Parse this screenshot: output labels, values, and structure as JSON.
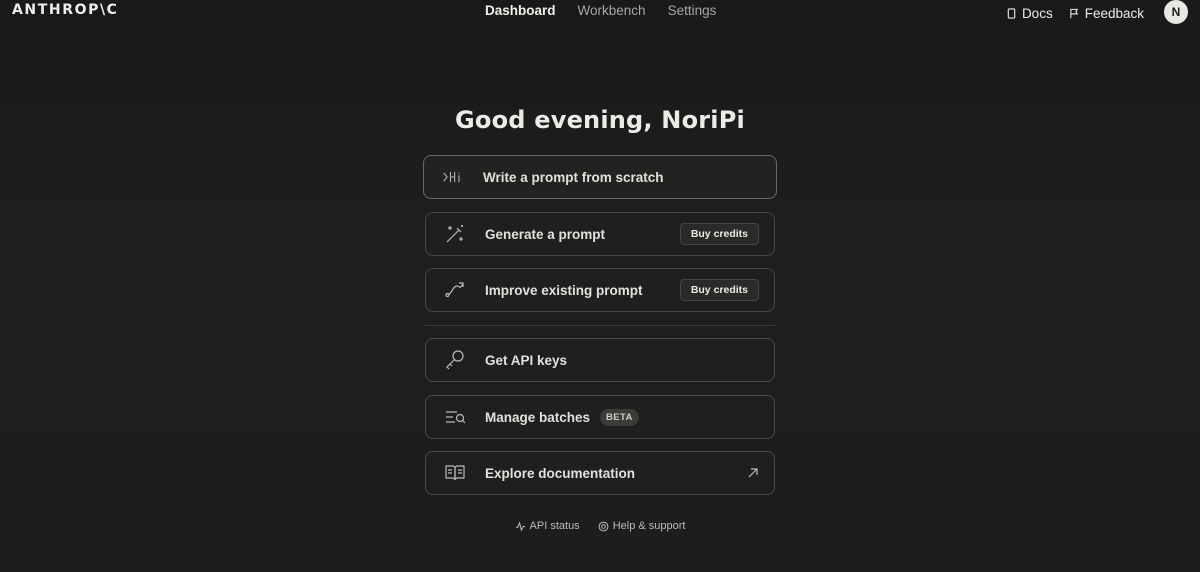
{
  "header": {
    "logo": "ANTHROP\\C",
    "tabs": [
      {
        "label": "Dashboard",
        "active": true
      },
      {
        "label": "Workbench",
        "active": false
      },
      {
        "label": "Settings",
        "active": false
      }
    ],
    "docs_label": "Docs",
    "feedback_label": "Feedback",
    "avatar_initial": "N"
  },
  "greeting": "Good evening, NoriPi",
  "actions": [
    {
      "label": "Write a prompt from scratch",
      "icon": "terminal-hi-icon"
    },
    {
      "label": "Generate a prompt",
      "icon": "magic-wand-icon",
      "button": "Buy credits"
    },
    {
      "label": "Improve existing prompt",
      "icon": "curve-arrow-icon",
      "button": "Buy credits"
    }
  ],
  "resources": [
    {
      "label": "Get API keys",
      "icon": "key-icon"
    },
    {
      "label": "Manage batches",
      "icon": "batch-list-icon",
      "badge": "BETA"
    },
    {
      "label": "Explore documentation",
      "icon": "book-icon",
      "external_icon": "external-link-icon"
    }
  ],
  "footer": {
    "api_status": "API status",
    "help": "Help & support"
  },
  "colors": {
    "background": "#1c1c1c",
    "card_border": "#4a4946",
    "text": "#e8e6e1"
  }
}
